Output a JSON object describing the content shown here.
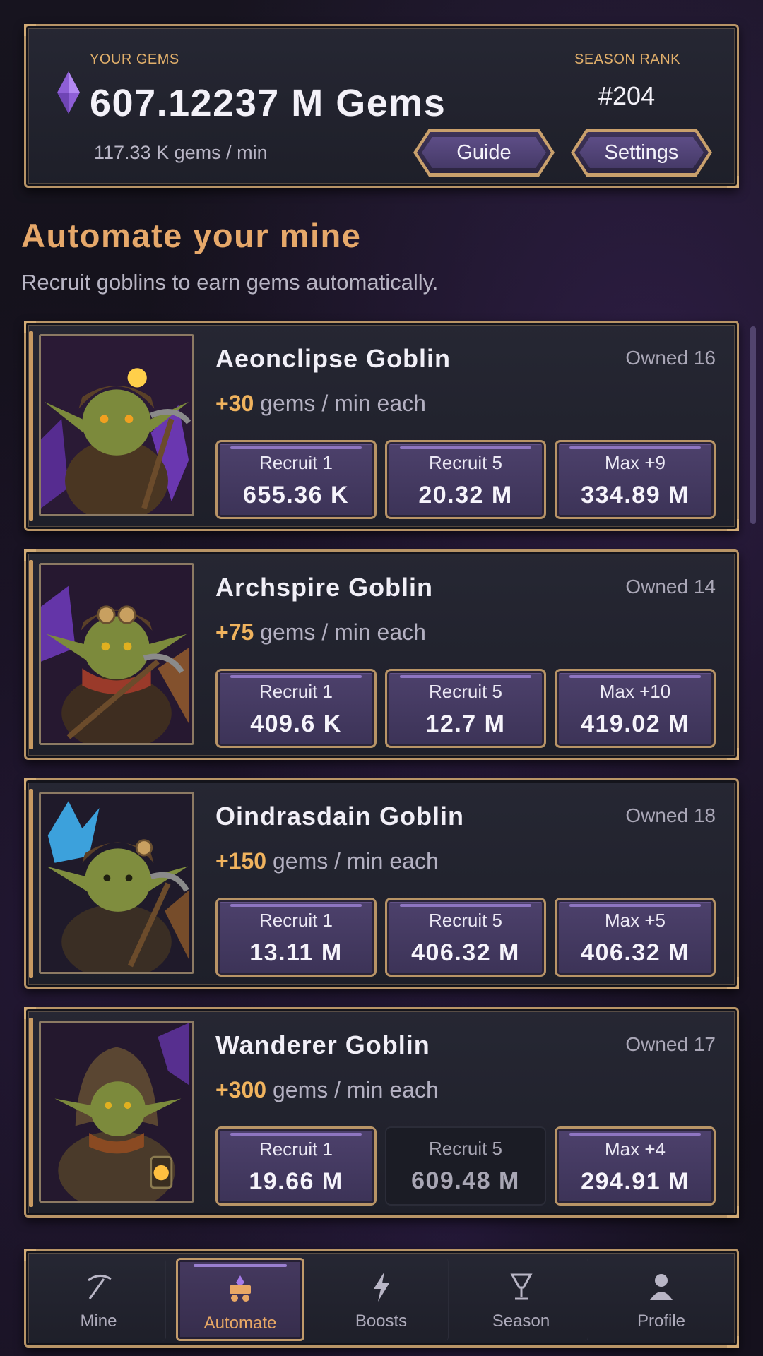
{
  "header": {
    "gems_label": "YOUR GEMS",
    "gems_total": "607.12237 M Gems",
    "gem_rate": "117.33 K gems / min",
    "rank_label": "SEASON RANK",
    "rank_value": "#204",
    "guide_label": "Guide",
    "settings_label": "Settings"
  },
  "section": {
    "title": "Automate your mine",
    "subtitle": "Recruit goblins to earn gems automatically."
  },
  "goblins": [
    {
      "name": "Aeonclipse Goblin",
      "owned": "Owned 16",
      "rate_amount": "+30",
      "rate_suffix": " gems / min each",
      "buttons": [
        {
          "label": "Recruit 1",
          "value": "655.36 K",
          "enabled": true
        },
        {
          "label": "Recruit 5",
          "value": "20.32 M",
          "enabled": true
        },
        {
          "label": "Max +9",
          "value": "334.89 M",
          "enabled": true
        }
      ]
    },
    {
      "name": "Archspire Goblin",
      "owned": "Owned 14",
      "rate_amount": "+75",
      "rate_suffix": " gems / min each",
      "buttons": [
        {
          "label": "Recruit 1",
          "value": "409.6 K",
          "enabled": true
        },
        {
          "label": "Recruit 5",
          "value": "12.7 M",
          "enabled": true
        },
        {
          "label": "Max +10",
          "value": "419.02 M",
          "enabled": true
        }
      ]
    },
    {
      "name": "Oindrasdain Goblin",
      "owned": "Owned 18",
      "rate_amount": "+150",
      "rate_suffix": " gems / min each",
      "buttons": [
        {
          "label": "Recruit 1",
          "value": "13.11 M",
          "enabled": true
        },
        {
          "label": "Recruit 5",
          "value": "406.32 M",
          "enabled": true
        },
        {
          "label": "Max +5",
          "value": "406.32 M",
          "enabled": true
        }
      ]
    },
    {
      "name": "Wanderer Goblin",
      "owned": "Owned 17",
      "rate_amount": "+300",
      "rate_suffix": " gems / min each",
      "buttons": [
        {
          "label": "Recruit 1",
          "value": "19.66 M",
          "enabled": true
        },
        {
          "label": "Recruit 5",
          "value": "609.48 M",
          "enabled": false
        },
        {
          "label": "Max +4",
          "value": "294.91 M",
          "enabled": true
        }
      ]
    }
  ],
  "nav": {
    "items": [
      {
        "label": "Mine",
        "icon": "pickaxe-icon"
      },
      {
        "label": "Automate",
        "icon": "minecart-icon",
        "active": true
      },
      {
        "label": "Boosts",
        "icon": "lightning-icon"
      },
      {
        "label": "Season",
        "icon": "trophy-icon"
      },
      {
        "label": "Profile",
        "icon": "person-icon"
      }
    ]
  },
  "colors": {
    "accent_gold": "#e2b06b",
    "title_orange": "#e6a86a",
    "button_purple": "#4d416c",
    "gem_purple": "#a57be8"
  }
}
